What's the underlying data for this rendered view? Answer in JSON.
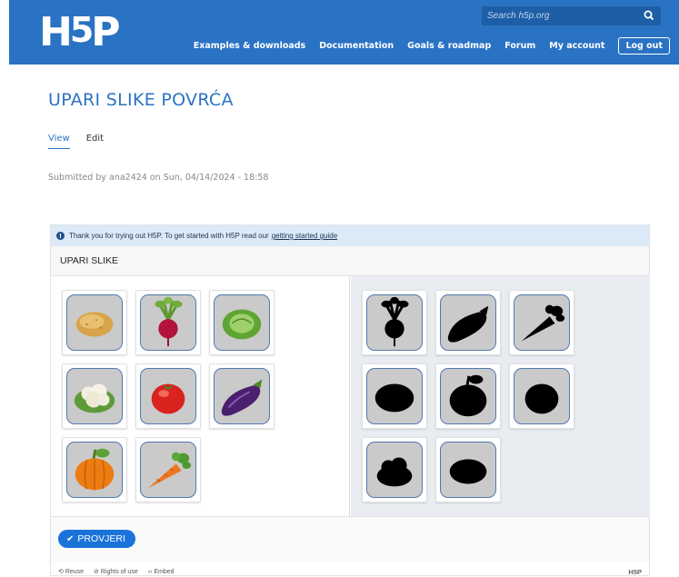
{
  "header": {
    "logo_text": "H5P",
    "search_placeholder": "Search h5p.org",
    "nav": [
      "Examples & downloads",
      "Documentation",
      "Goals & roadmap",
      "Forum",
      "My account"
    ],
    "logout_label": "Log out",
    "brand_color": "#2a73c4"
  },
  "page": {
    "title": "UPARI SLIKE POVRĆA",
    "tabs": [
      "View",
      "Edit"
    ],
    "submitted": "Submitted by ana2424 on Sun, 04/14/2024 - 18:58"
  },
  "h5p": {
    "notice_text": "Thank you for trying out H5P. To get started with H5P read our",
    "notice_link": "getting started guide",
    "task_title": "UPARI SLIKE",
    "pool_items": [
      "potato",
      "beet",
      "cabbage",
      "cauliflower",
      "tomato",
      "eggplant",
      "pumpkin",
      "carrot"
    ],
    "zone_items": [
      "beet-silhouette",
      "eggplant-silhouette",
      "carrot-silhouette",
      "cabbage-silhouette",
      "pumpkin-silhouette",
      "tomato-silhouette",
      "cauliflower-silhouette",
      "potato-silhouette"
    ],
    "check_label": "PROVJERI",
    "actions": [
      "Reuse",
      "Rights of use",
      "Embed"
    ],
    "footer_logo": "H5P"
  }
}
